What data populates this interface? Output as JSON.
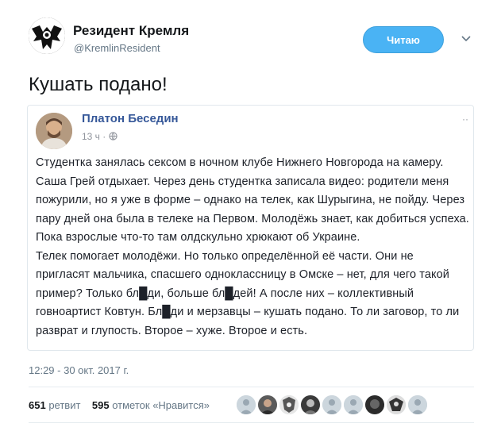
{
  "author": {
    "name": "Резидент Кремля",
    "handle": "@KremlinResident",
    "follow_label": "Читаю"
  },
  "tweet": {
    "text": "Кушать подано!",
    "timestamp": "12:29 - 30 окт. 2017 г."
  },
  "quoted_post": {
    "author": "Платон Беседин",
    "time": "13 ч",
    "dots": "··",
    "paragraphs": [
      "Студентка занялась сексом в ночном клубе Нижнего Новгорода на камеру. Саша Грей отдыхает. Через день студентка записала видео: родители меня пожурили, но я уже в форме – однако на телек, как Шурыгина, не пойду. Через пару дней она была в телеке на Первом. Молодёжь знает, как добиться успеха. Пока взрослые что-то там олдскульно хрюкают об Украине.",
      "Телек помогает молодёжи. Но только определённой её части. Они не пригласят мальчика, спасшего одноклассницу в Омске – нет, для чего такой пример? Только бл█ди, больше бл█дей! А после них – коллективный говноартист Ковтун. Бл█ди и мерзавцы – кушать подано. То ли заговор, то ли разврат и глупость. Второе – хуже. Второе и есть."
    ]
  },
  "stats": {
    "retweets_count": "651",
    "retweets_label": "ретвит",
    "likes_count": "595",
    "likes_label": "отметок «Нравится»"
  },
  "colors": {
    "follow_button": "#4ab3f4",
    "quote_author": "#365899",
    "meta_gray": "#657786"
  }
}
